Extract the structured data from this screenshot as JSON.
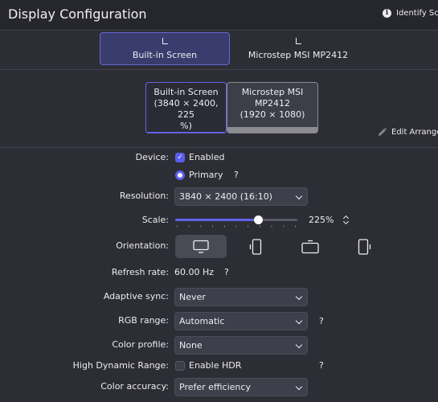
{
  "window": {
    "title": "Display Configuration",
    "identify_label": "Identify Scr"
  },
  "screens": {
    "tabs": [
      {
        "label": "Built-in Screen",
        "active": true
      },
      {
        "label": "Microstep MSI MP2412",
        "active": false
      }
    ]
  },
  "arrangement": {
    "builtin_line1": "Built-in Screen",
    "builtin_line2": "(3840 × 2400, 225",
    "builtin_line3": "%)",
    "msi_line1": "Microstep MSI",
    "msi_line2": "MP2412",
    "msi_line3": "(1920 × 1080)",
    "edit_label": "Edit Arrange"
  },
  "settings": {
    "device_label": "Device:",
    "enabled_label": "Enabled",
    "enabled_checked": true,
    "primary_label": "Primary",
    "help_mark": "?",
    "resolution_label": "Resolution:",
    "resolution_value": "3840 × 2400 (16:10)",
    "scale_label": "Scale:",
    "scale_value": "225%",
    "scale_fraction": 0.68,
    "orientation_label": "Orientation:",
    "orientation_selected": "landscape",
    "refresh_label": "Refresh rate:",
    "refresh_value": "60.00 Hz",
    "adaptive_label": "Adaptive sync:",
    "adaptive_value": "Never",
    "rgb_label": "RGB range:",
    "rgb_value": "Automatic",
    "profile_label": "Color profile:",
    "profile_value": "None",
    "hdr_label": "High Dynamic Range:",
    "hdr_enable_label": "Enable HDR",
    "accuracy_label": "Color accuracy:",
    "accuracy_value": "Prefer efficiency"
  },
  "colors": {
    "accent": "#5e62e8",
    "background": "#2d2d35",
    "titlebar": "#26262d"
  }
}
